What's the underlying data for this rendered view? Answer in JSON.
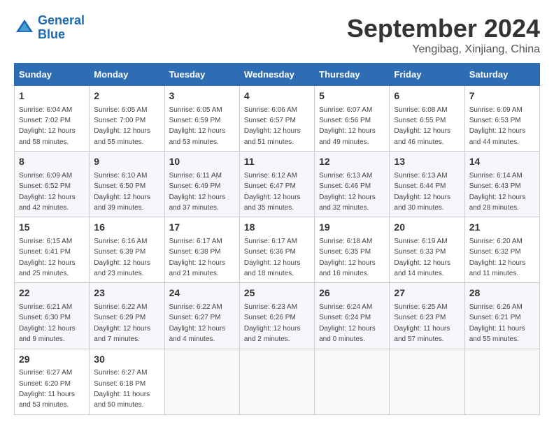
{
  "header": {
    "logo_line1": "General",
    "logo_line2": "Blue",
    "month": "September 2024",
    "location": "Yengibag, Xinjiang, China"
  },
  "weekdays": [
    "Sunday",
    "Monday",
    "Tuesday",
    "Wednesday",
    "Thursday",
    "Friday",
    "Saturday"
  ],
  "weeks": [
    [
      {
        "day": "1",
        "sunrise": "6:04 AM",
        "sunset": "7:02 PM",
        "daylight": "12 hours and 58 minutes."
      },
      {
        "day": "2",
        "sunrise": "6:05 AM",
        "sunset": "7:00 PM",
        "daylight": "12 hours and 55 minutes."
      },
      {
        "day": "3",
        "sunrise": "6:05 AM",
        "sunset": "6:59 PM",
        "daylight": "12 hours and 53 minutes."
      },
      {
        "day": "4",
        "sunrise": "6:06 AM",
        "sunset": "6:57 PM",
        "daylight": "12 hours and 51 minutes."
      },
      {
        "day": "5",
        "sunrise": "6:07 AM",
        "sunset": "6:56 PM",
        "daylight": "12 hours and 49 minutes."
      },
      {
        "day": "6",
        "sunrise": "6:08 AM",
        "sunset": "6:55 PM",
        "daylight": "12 hours and 46 minutes."
      },
      {
        "day": "7",
        "sunrise": "6:09 AM",
        "sunset": "6:53 PM",
        "daylight": "12 hours and 44 minutes."
      }
    ],
    [
      {
        "day": "8",
        "sunrise": "6:09 AM",
        "sunset": "6:52 PM",
        "daylight": "12 hours and 42 minutes."
      },
      {
        "day": "9",
        "sunrise": "6:10 AM",
        "sunset": "6:50 PM",
        "daylight": "12 hours and 39 minutes."
      },
      {
        "day": "10",
        "sunrise": "6:11 AM",
        "sunset": "6:49 PM",
        "daylight": "12 hours and 37 minutes."
      },
      {
        "day": "11",
        "sunrise": "6:12 AM",
        "sunset": "6:47 PM",
        "daylight": "12 hours and 35 minutes."
      },
      {
        "day": "12",
        "sunrise": "6:13 AM",
        "sunset": "6:46 PM",
        "daylight": "12 hours and 32 minutes."
      },
      {
        "day": "13",
        "sunrise": "6:13 AM",
        "sunset": "6:44 PM",
        "daylight": "12 hours and 30 minutes."
      },
      {
        "day": "14",
        "sunrise": "6:14 AM",
        "sunset": "6:43 PM",
        "daylight": "12 hours and 28 minutes."
      }
    ],
    [
      {
        "day": "15",
        "sunrise": "6:15 AM",
        "sunset": "6:41 PM",
        "daylight": "12 hours and 25 minutes."
      },
      {
        "day": "16",
        "sunrise": "6:16 AM",
        "sunset": "6:39 PM",
        "daylight": "12 hours and 23 minutes."
      },
      {
        "day": "17",
        "sunrise": "6:17 AM",
        "sunset": "6:38 PM",
        "daylight": "12 hours and 21 minutes."
      },
      {
        "day": "18",
        "sunrise": "6:17 AM",
        "sunset": "6:36 PM",
        "daylight": "12 hours and 18 minutes."
      },
      {
        "day": "19",
        "sunrise": "6:18 AM",
        "sunset": "6:35 PM",
        "daylight": "12 hours and 16 minutes."
      },
      {
        "day": "20",
        "sunrise": "6:19 AM",
        "sunset": "6:33 PM",
        "daylight": "12 hours and 14 minutes."
      },
      {
        "day": "21",
        "sunrise": "6:20 AM",
        "sunset": "6:32 PM",
        "daylight": "12 hours and 11 minutes."
      }
    ],
    [
      {
        "day": "22",
        "sunrise": "6:21 AM",
        "sunset": "6:30 PM",
        "daylight": "12 hours and 9 minutes."
      },
      {
        "day": "23",
        "sunrise": "6:22 AM",
        "sunset": "6:29 PM",
        "daylight": "12 hours and 7 minutes."
      },
      {
        "day": "24",
        "sunrise": "6:22 AM",
        "sunset": "6:27 PM",
        "daylight": "12 hours and 4 minutes."
      },
      {
        "day": "25",
        "sunrise": "6:23 AM",
        "sunset": "6:26 PM",
        "daylight": "12 hours and 2 minutes."
      },
      {
        "day": "26",
        "sunrise": "6:24 AM",
        "sunset": "6:24 PM",
        "daylight": "12 hours and 0 minutes."
      },
      {
        "day": "27",
        "sunrise": "6:25 AM",
        "sunset": "6:23 PM",
        "daylight": "11 hours and 57 minutes."
      },
      {
        "day": "28",
        "sunrise": "6:26 AM",
        "sunset": "6:21 PM",
        "daylight": "11 hours and 55 minutes."
      }
    ],
    [
      {
        "day": "29",
        "sunrise": "6:27 AM",
        "sunset": "6:20 PM",
        "daylight": "11 hours and 53 minutes."
      },
      {
        "day": "30",
        "sunrise": "6:27 AM",
        "sunset": "6:18 PM",
        "daylight": "11 hours and 50 minutes."
      },
      null,
      null,
      null,
      null,
      null
    ]
  ]
}
